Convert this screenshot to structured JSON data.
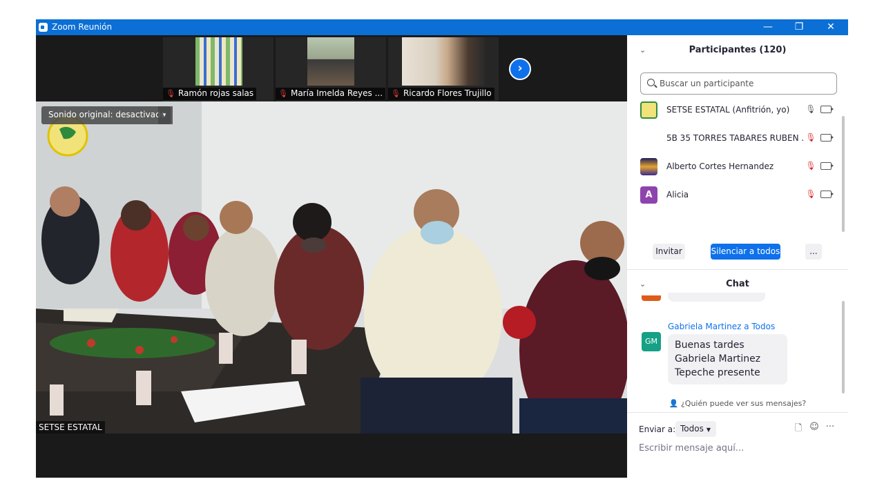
{
  "window": {
    "title": "Zoom Reunión",
    "controls": {
      "minimize": "—",
      "restore": "❐",
      "close": "✕"
    }
  },
  "thumbnails": [
    {
      "name": "Ramón rojas salas"
    },
    {
      "name": "María Imelda Reyes ..."
    },
    {
      "name": "Ricardo Flores Trujillo"
    }
  ],
  "next_arrow": "›",
  "video": {
    "original_sound": "Sonido original: desactivado",
    "dropdown": "▾",
    "speaker_name": "SETSE ESTATAL"
  },
  "participants": {
    "header": "Participantes (120)",
    "chevron": "⌄",
    "search_placeholder": "Buscar un participante",
    "list": [
      {
        "name": "SETSE ESTATAL (Anfitrión, yo)",
        "muted": false
      },
      {
        "name": "5B 35 TORRES TABARES RUBEN ...",
        "muted": true
      },
      {
        "name": "Alberto Cortes Hernandez",
        "muted": true
      },
      {
        "name": "Alicia",
        "muted": true,
        "initial": "A"
      }
    ],
    "buttons": {
      "invite": "Invitar",
      "mute_all": "Silenciar a todos",
      "more": "..."
    }
  },
  "chat": {
    "header": "Chat",
    "message": {
      "initials": "GM",
      "from": "Gabriela Martinez a Todos",
      "text": "Buenas tardes Gabriela Martinez Tepeche presente"
    },
    "who_can_see": "¿Quién puede ver sus mensajes?",
    "send_to_label": "Enviar a:",
    "send_to_value": "Todos",
    "placeholder": "Escribir mensaje aquí...",
    "more": "···"
  },
  "colors": {
    "accent": "#0e71eb",
    "titlebar": "#0b6fd6",
    "muted": "#e02828",
    "avatar_gm": "#16a085",
    "avatar_a": "#8e44ad"
  }
}
